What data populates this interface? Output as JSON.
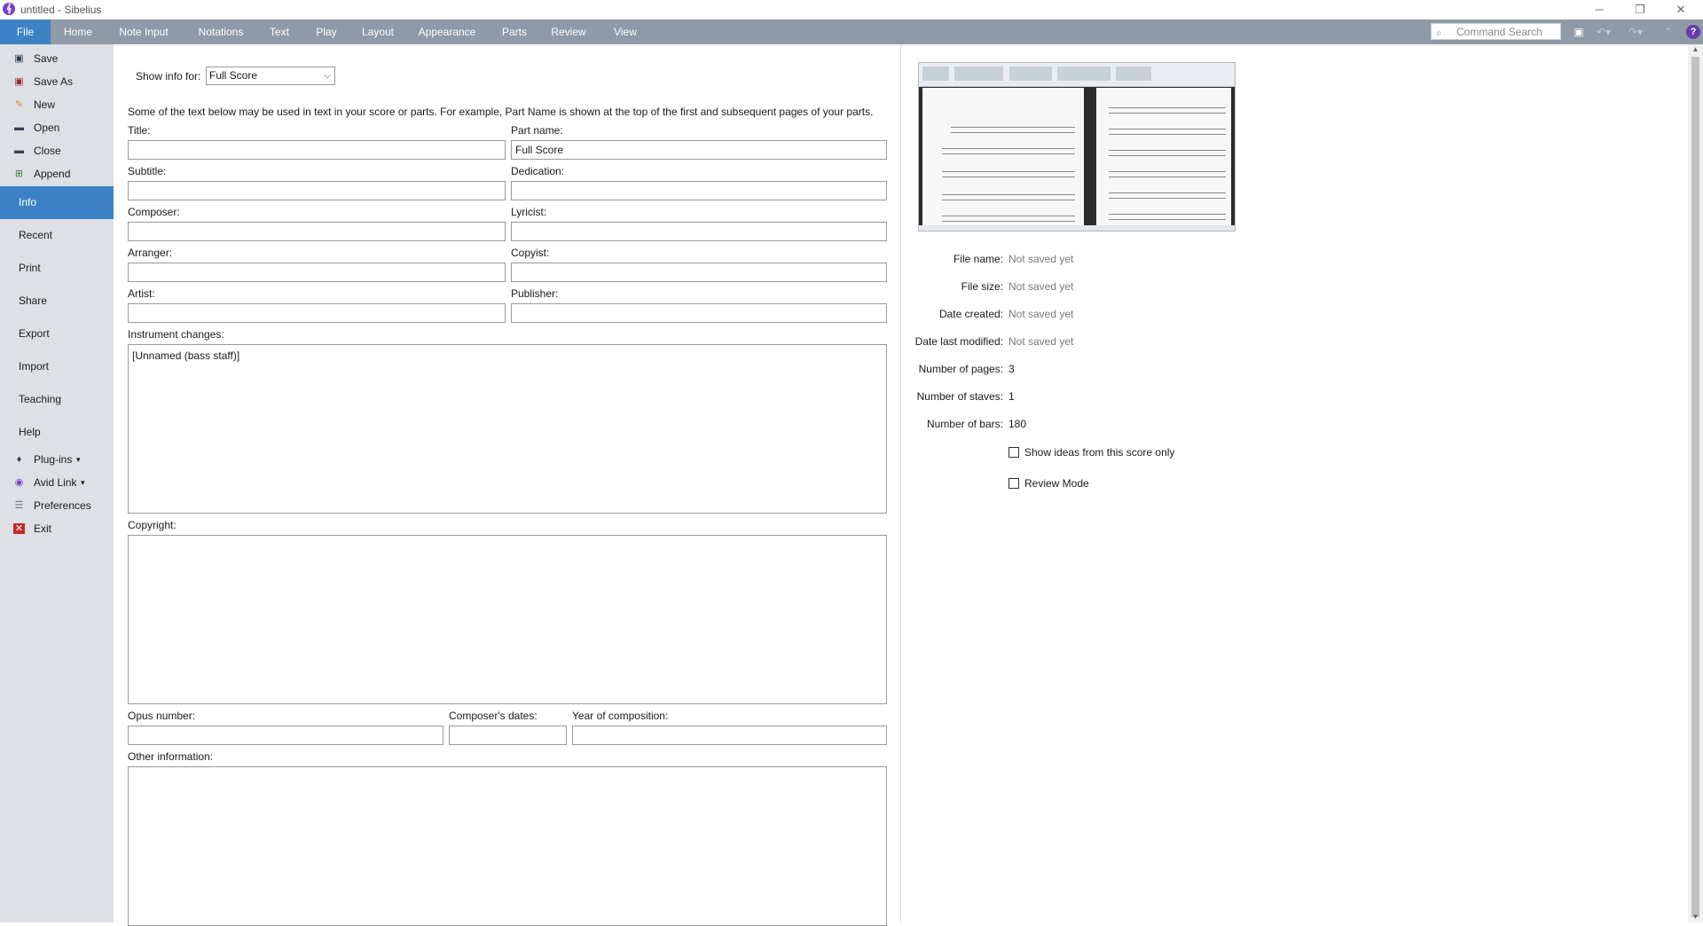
{
  "window": {
    "title": "untitled - Sibelius",
    "logo": "sibelius-logo"
  },
  "ribbon": {
    "tabs": [
      "File",
      "Home",
      "Note Input",
      "Notations",
      "Text",
      "Play",
      "Layout",
      "Appearance",
      "Parts",
      "Review",
      "View"
    ],
    "active_tab": "File",
    "command_search_placeholder": "Command Search",
    "accent": "#3c82c4"
  },
  "sidebar": {
    "top_items": [
      {
        "label": "Save",
        "icon": "save-icon"
      },
      {
        "label": "Save As",
        "icon": "save-as-icon"
      },
      {
        "label": "New",
        "icon": "new-file-icon"
      },
      {
        "label": "Open",
        "icon": "folder-icon"
      },
      {
        "label": "Close",
        "icon": "close-file-icon"
      },
      {
        "label": "Append",
        "icon": "append-icon"
      }
    ],
    "pages": [
      "Info",
      "Recent",
      "Print",
      "Share",
      "Export",
      "Import",
      "Teaching",
      "Help"
    ],
    "active_page": "Info",
    "bottom_items": [
      {
        "label": "Plug-ins",
        "icon": "plugin-icon",
        "dropdown": "▾"
      },
      {
        "label": "Avid Link",
        "icon": "avid-link-icon",
        "dropdown": "▾"
      },
      {
        "label": "Preferences",
        "icon": "preferences-icon"
      },
      {
        "label": "Exit",
        "icon": "exit-icon"
      }
    ]
  },
  "info": {
    "show_info_label": "Show info for:",
    "show_info_value": "Full Score",
    "hint": "Some of the text below may be used in text in your score or parts. For example, Part Name is shown at the top of the first and subsequent pages of your parts.",
    "fields": {
      "title": {
        "label": "Title:",
        "value": ""
      },
      "part_name": {
        "label": "Part name:",
        "value": "Full Score"
      },
      "subtitle": {
        "label": "Subtitle:",
        "value": ""
      },
      "dedication": {
        "label": "Dedication:",
        "value": ""
      },
      "composer": {
        "label": "Composer:",
        "value": ""
      },
      "lyricist": {
        "label": "Lyricist:",
        "value": ""
      },
      "arranger": {
        "label": "Arranger:",
        "value": ""
      },
      "copyist": {
        "label": "Copyist:",
        "value": ""
      },
      "artist": {
        "label": "Artist:",
        "value": ""
      },
      "publisher": {
        "label": "Publisher:",
        "value": ""
      },
      "instrument_changes": {
        "label": "Instrument changes:",
        "value": "[Unnamed (bass staff)]"
      },
      "copyright": {
        "label": "Copyright:",
        "value": ""
      },
      "opus_number": {
        "label": "Opus number:",
        "value": ""
      },
      "composers_dates": {
        "label": "Composer's dates:",
        "value": ""
      },
      "year_of_composition": {
        "label": "Year of composition:",
        "value": ""
      },
      "other_information": {
        "label": "Other information:",
        "value": ""
      }
    }
  },
  "file_info": {
    "file_name": {
      "label": "File name:",
      "value": "Not saved yet"
    },
    "file_size": {
      "label": "File size:",
      "value": "Not saved yet"
    },
    "date_created": {
      "label": "Date created:",
      "value": "Not saved yet"
    },
    "date_last_modified": {
      "label": "Date last modified:",
      "value": "Not saved yet"
    },
    "number_of_pages": {
      "label": "Number of pages:",
      "value": "3"
    },
    "number_of_staves": {
      "label": "Number of staves:",
      "value": "1"
    },
    "number_of_bars": {
      "label": "Number of bars:",
      "value": "180"
    },
    "show_ideas_checkbox": {
      "label": "Show ideas from this score only",
      "checked": false
    },
    "review_mode_checkbox": {
      "label": "Review Mode",
      "checked": false
    }
  }
}
